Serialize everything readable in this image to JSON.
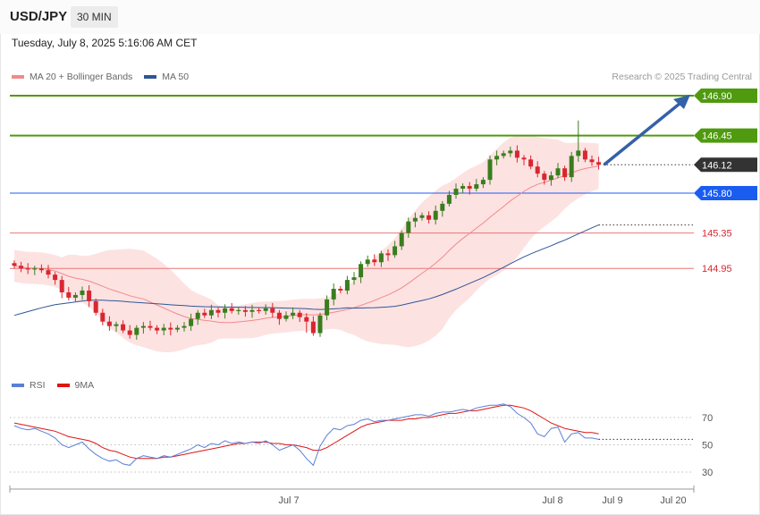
{
  "header": {
    "symbol": "USD/JPY",
    "timeframe": "30 MIN"
  },
  "datetime": "Tuesday, July 8, 2025 5:16:06 AM CET",
  "legend_main": [
    {
      "label": "MA 20 + Bollinger Bands",
      "color": "#f08a8a"
    },
    {
      "label": "MA 50",
      "color": "#2f5596"
    }
  ],
  "credit": "Research © 2025 Trading Central",
  "legend_rsi": [
    {
      "label": "RSI",
      "color": "#5b7fd6"
    },
    {
      "label": "9MA",
      "color": "#e01414"
    }
  ],
  "colors": {
    "up": "#3a7d1e",
    "down": "#d9262f",
    "resistance": "#4f9a0f",
    "pivot": "#1a5cf0",
    "support": "#e87777",
    "current": "#333333",
    "ma20": "#f08a8a",
    "ma50": "#2f5596",
    "band": "#fde2e2",
    "rsi": "#5b7fd6",
    "rsi_ma": "#e01414",
    "arrow": "#3461a8"
  },
  "chart_data": {
    "type": "candlestick",
    "price_range": [
      144.3,
      147.2
    ],
    "levels": [
      {
        "label": "146.90",
        "value": 146.9,
        "kind": "resistance"
      },
      {
        "label": "146.45",
        "value": 146.45,
        "kind": "resistance"
      },
      {
        "label": "146.12",
        "value": 146.12,
        "kind": "current"
      },
      {
        "label": "145.80",
        "value": 145.8,
        "kind": "pivot"
      },
      {
        "label": "145.35",
        "value": 145.35,
        "kind": "support"
      },
      {
        "label": "144.95",
        "value": 144.95,
        "kind": "support"
      }
    ],
    "x_labels": [
      "Jul 7",
      "Jul 8",
      "Jul 9",
      "Jul 20"
    ],
    "rsi_ticks": [
      "70",
      "50",
      "30"
    ],
    "rsi_levels": [
      70,
      50,
      30
    ],
    "rsi_range": [
      20,
      80
    ],
    "close": [
      144.98,
      144.95,
      144.94,
      144.95,
      144.93,
      144.88,
      144.82,
      144.68,
      144.62,
      144.65,
      144.7,
      144.58,
      144.45,
      144.35,
      144.3,
      144.32,
      144.25,
      144.2,
      144.28,
      144.3,
      144.28,
      144.25,
      144.28,
      144.26,
      144.28,
      144.3,
      144.38,
      144.45,
      144.42,
      144.48,
      144.45,
      144.5,
      144.47,
      144.48,
      144.46,
      144.48,
      144.47,
      144.5,
      144.45,
      144.38,
      144.42,
      144.45,
      144.4,
      144.35,
      144.22,
      144.42,
      144.6,
      144.72,
      144.7,
      144.82,
      144.85,
      145.0,
      145.05,
      145.02,
      145.12,
      145.1,
      145.2,
      145.35,
      145.48,
      145.52,
      145.55,
      145.5,
      145.6,
      145.68,
      145.78,
      145.85,
      145.88,
      145.85,
      145.9,
      145.95,
      146.18,
      146.22,
      146.25,
      146.28,
      146.2,
      146.18,
      146.1,
      146.02,
      145.95,
      146.0,
      146.08,
      145.98,
      146.22,
      146.28,
      146.18,
      146.15,
      146.12
    ],
    "rsi": [
      64,
      62,
      61,
      62,
      60,
      58,
      55,
      50,
      48,
      50,
      52,
      47,
      43,
      40,
      38,
      39,
      36,
      35,
      40,
      42,
      41,
      40,
      42,
      41,
      43,
      45,
      47,
      50,
      48,
      51,
      50,
      53,
      51,
      52,
      51,
      52,
      51,
      53,
      50,
      46,
      48,
      50,
      46,
      40,
      35,
      49,
      57,
      62,
      61,
      64,
      65,
      68,
      69,
      67,
      68,
      68,
      69,
      70,
      71,
      72,
      72,
      71,
      73,
      74,
      74,
      75,
      76,
      75,
      77,
      78,
      79,
      79,
      80,
      78,
      73,
      70,
      66,
      58,
      56,
      62,
      63,
      52,
      58,
      59,
      55,
      55,
      54
    ],
    "rsi_ma": [
      66,
      65,
      64,
      63,
      62,
      61,
      60,
      58,
      56,
      55,
      54,
      53,
      51,
      48,
      46,
      45,
      43,
      41,
      40,
      40,
      40,
      40,
      41,
      41,
      42,
      43,
      44,
      45,
      46,
      47,
      48,
      49,
      50,
      51,
      51,
      52,
      52,
      52,
      51,
      51,
      50,
      50,
      49,
      48,
      46,
      46,
      48,
      51,
      54,
      57,
      60,
      63,
      65,
      66,
      67,
      68,
      68,
      68,
      69,
      69,
      70,
      70,
      71,
      72,
      73,
      73,
      74,
      75,
      75,
      76,
      77,
      78,
      79,
      79,
      78,
      77,
      75,
      72,
      69,
      66,
      64,
      62,
      61,
      60,
      59,
      59,
      58
    ]
  }
}
